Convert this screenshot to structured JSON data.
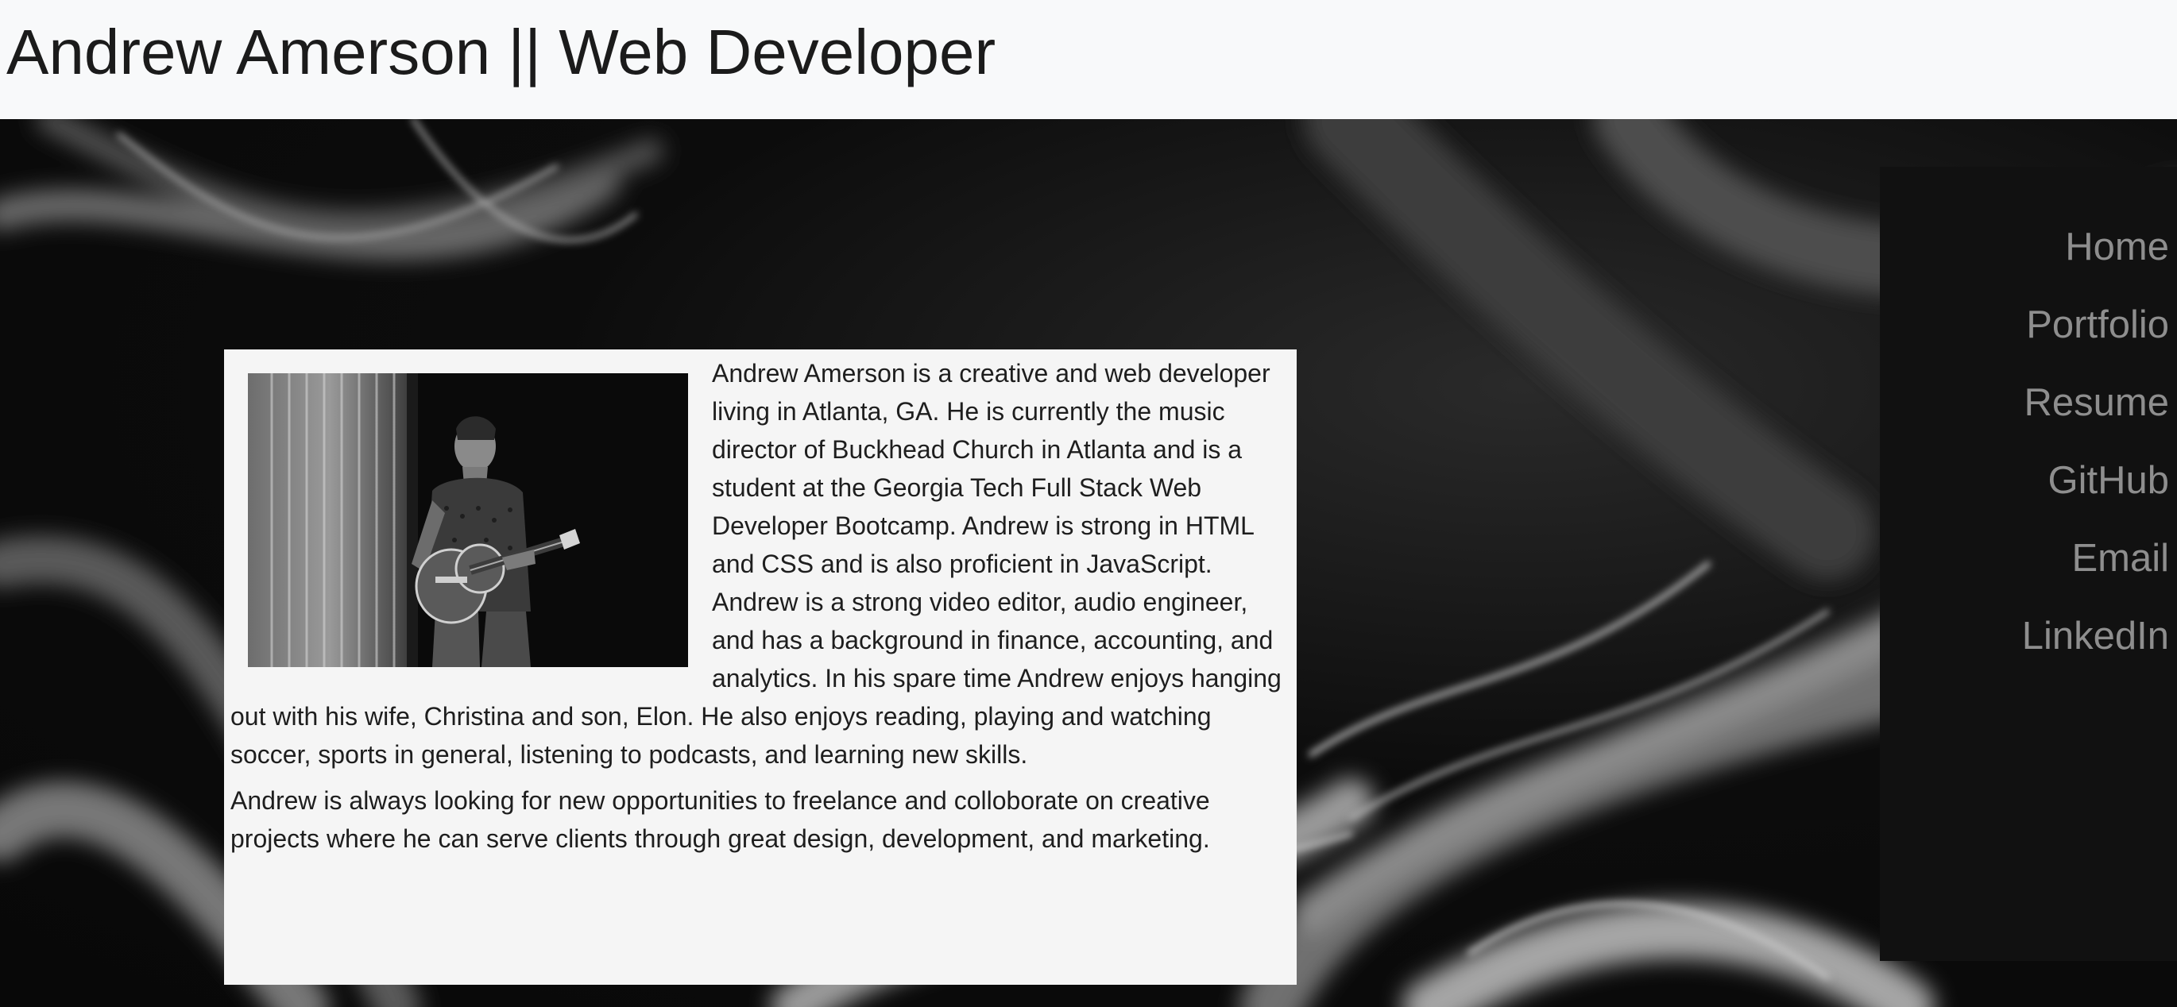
{
  "header": {
    "title": "Andrew Amerson || Web Developer"
  },
  "about": {
    "photo_icon": "guitarist-photo",
    "paragraph_1": "Andrew Amerson is a creative and web developer living in Atlanta, GA. He is currently the music director of Buckhead Church in Atlanta and is a student at the Georgia Tech Full Stack Web Developer Bootcamp. Andrew is strong in HTML and CSS and is also proficient in JavaScript. Andrew is a strong video editor, audio engineer, and has a background in finance, accounting, and analytics. In his spare time Andrew enjoys hanging out with his wife, Christina and son, Elon. He also enjoys reading, playing and watching soccer, sports in general, listening to podcasts, and learning new skills.",
    "paragraph_2": "Andrew is always looking for new opportunities to freelance and colloborate on creative projects where he can serve clients through great design, development, and marketing."
  },
  "nav": {
    "items": [
      {
        "label": "Home"
      },
      {
        "label": "Portfolio"
      },
      {
        "label": "Resume"
      },
      {
        "label": "GitHub"
      },
      {
        "label": "Email"
      },
      {
        "label": "LinkedIn"
      }
    ]
  },
  "colors": {
    "header_bg": "#f8f9fa",
    "card_bg": "#f5f5f5",
    "nav_bg": "#111111",
    "nav_text": "#8e8e8e"
  }
}
